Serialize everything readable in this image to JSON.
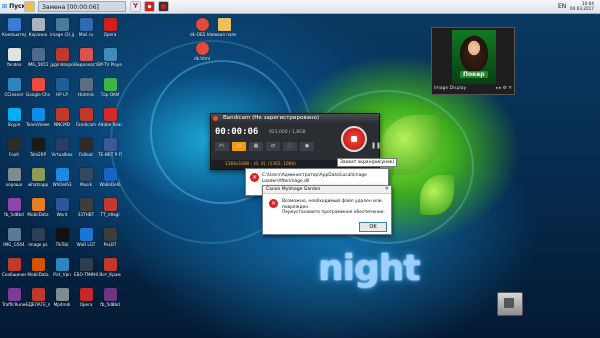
{
  "taskbar": {
    "start_label": "Пуск",
    "items": [
      {
        "label": "Замена [00:00:06]"
      }
    ],
    "tray_time": "10:04",
    "tray_date": "04.03.2017",
    "tray_lang": "EN"
  },
  "desktop": {
    "icons": [
      {
        "label": "Компьютер",
        "color": "#3a7bd5"
      },
      {
        "label": "Корзина",
        "color": "#aab2bd"
      },
      {
        "label": "image (2).jpg",
        "color": "#4a7c9b"
      },
      {
        "label": "Mail.ru",
        "color": "#2d6ab0"
      },
      {
        "label": "Opera",
        "color": "#d11e1e"
      },
      {
        "label": "Yandex",
        "color": "#e2e2e2"
      },
      {
        "label": "IMG_5651",
        "color": "#4f6a8a"
      },
      {
        "label": "jpgindexpo",
        "color": "#c0392b"
      },
      {
        "label": "Видеохостинг",
        "color": "#d9534f"
      },
      {
        "label": "BY-TV Player",
        "color": "#3c8dbc"
      },
      {
        "label": "CCleaner",
        "color": "#2e86c1"
      },
      {
        "label": "Google Chrome",
        "color": "#e74c3c"
      },
      {
        "label": "HP LP",
        "color": "#1f5f99"
      },
      {
        "label": "Hotmils",
        "color": "#5d6d7e"
      },
      {
        "label": "Тор ОКИ",
        "color": "#3ab54a"
      },
      {
        "label": "Skype",
        "color": "#00aff0"
      },
      {
        "label": "TeamViewer",
        "color": "#0e8ee9"
      },
      {
        "label": "NNCMD",
        "color": "#c0392b"
      },
      {
        "label": "Fandicam",
        "color": "#c0392b"
      },
      {
        "label": "Adobe Reader X",
        "color": "#d22a2a"
      },
      {
        "label": "Foxit",
        "color": "#2c2c2c"
      },
      {
        "label": "Tele2RP",
        "color": "#1a1a1a"
      },
      {
        "label": "Virtualbox",
        "color": "#263e68"
      },
      {
        "label": "Fallout",
        "color": "#2b2b2b"
      },
      {
        "label": "ТЕ-ИВТ Р-Пульс",
        "color": "#3b5998"
      },
      {
        "label": "хорошо",
        "color": "#7f8c8d"
      },
      {
        "label": "whatsapp",
        "color": "#8e9b57"
      },
      {
        "label": "WhDel63",
        "color": "#1e88e5"
      },
      {
        "label": "Musik",
        "color": "#34495e"
      },
      {
        "label": "WaBsDel6",
        "color": "#1565c0"
      },
      {
        "label": "fb_5d8bd",
        "color": "#8e44ad"
      },
      {
        "label": "MobilData",
        "color": "#e67e22"
      },
      {
        "label": "Word",
        "color": "#2b579a"
      },
      {
        "label": "ЗЗТНВТ",
        "color": "#3d3d3d"
      },
      {
        "label": "TT_rdlagi",
        "color": "#c0392b"
      },
      {
        "label": "IMG_G564",
        "color": "#5b7a99"
      },
      {
        "label": "image ps",
        "color": "#2e4053"
      },
      {
        "label": "TikTok",
        "color": "#111111"
      },
      {
        "label": "WoB LGT",
        "color": "#1976d2"
      },
      {
        "label": "РеLBT",
        "color": "#3d3d3d"
      },
      {
        "label": "Сообщения",
        "color": "#c0392b"
      },
      {
        "label": "MobilData",
        "color": "#d35400"
      },
      {
        "label": "Pict_Vpn",
        "color": "#2e86c1"
      },
      {
        "label": "ЕБО-ТМИНО",
        "color": "#2c3e50"
      },
      {
        "label": "Вот_Крам",
        "color": "#c0392b"
      },
      {
        "label": "TrafficRunes",
        "color": "#7d3c98"
      },
      {
        "label": "ЕДЕЛАГЕ_mp4",
        "color": "#c0392b"
      },
      {
        "label": "Mp4mdi",
        "color": "#7f8c8d"
      },
      {
        "label": "Opera",
        "color": "#c62828"
      },
      {
        "label": "fb_5d8bd",
        "color": "#6c3483"
      },
      {
        "label": "Viber",
        "color": "#6f3fb5"
      },
      {
        "label": "DapMRS4.2",
        "color": "#555555"
      },
      {
        "label": "Ватсап_5",
        "color": "#3ab54a"
      },
      {
        "label": "Shareman",
        "color": "#d35400"
      }
    ],
    "top_icons": [
      {
        "label": "dk-ОБ5.html",
        "color": "#e04b3a"
      },
      {
        "label": "новая папка",
        "color": "#e8c15a"
      },
      {
        "label": "dk.html",
        "color": "#e04b3a"
      }
    ],
    "wallpaper_text": "night"
  },
  "bandicam": {
    "title": "Bandicam (Не зарегистрировано)",
    "timer": "00:00:06",
    "size": "921,000 / 1,8GB",
    "status": "1366x1080 - (0, 0), (1365, 1080)",
    "tooltip": "Захват экран(рисунок)",
    "tools": [
      "🎮",
      "▭",
      "▦",
      "⇄",
      "🎥",
      "◉"
    ]
  },
  "dialog_back": {
    "title": "",
    "message": "C:\\Users\\Администратор\\AppData\\Local\\image Loader\\Afterimage.dll"
  },
  "dialog_front": {
    "title": "Canon MyImage Garden",
    "message_line1": "Возможно, необходимый файл удален или поврежден.",
    "message_line2": "Переустановите программное обеспечение.",
    "ok_label": "OK"
  },
  "image_display": {
    "caption": "Image Display",
    "badge": "Покер"
  }
}
